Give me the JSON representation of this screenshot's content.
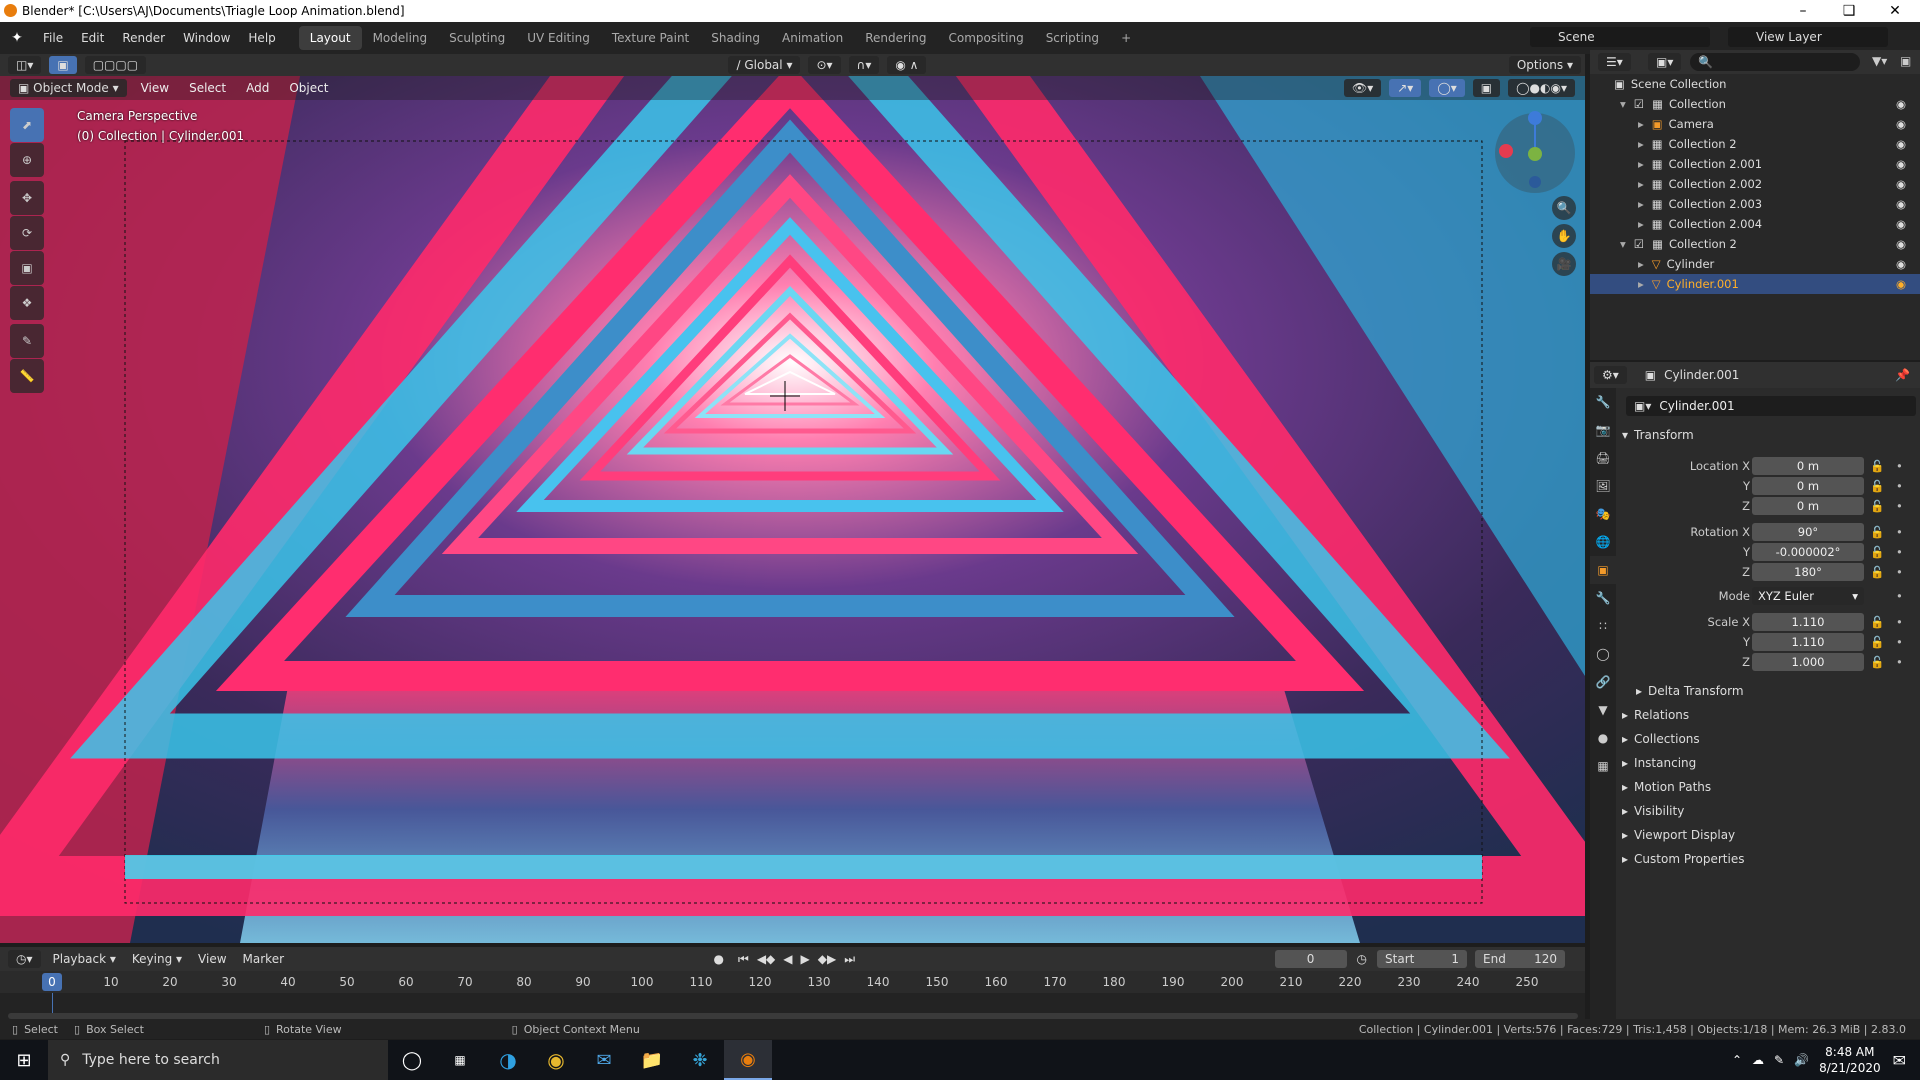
{
  "window": {
    "title": "Blender* [C:\\Users\\AJ\\Documents\\Triagle Loop Animation.blend]"
  },
  "menu": [
    "File",
    "Edit",
    "Render",
    "Window",
    "Help"
  ],
  "workspaces": [
    "Layout",
    "Modeling",
    "Sculpting",
    "UV Editing",
    "Texture Paint",
    "Shading",
    "Animation",
    "Rendering",
    "Compositing",
    "Scripting"
  ],
  "scene": {
    "name": "Scene",
    "view_layer": "View Layer"
  },
  "viewport_header": {
    "orientation": "Global",
    "options": "Options"
  },
  "viewport_menu": {
    "mode": "Object Mode",
    "items": [
      "View",
      "Select",
      "Add",
      "Object"
    ]
  },
  "viewport_overlay": {
    "line1": "Camera Perspective",
    "line2": "(0) Collection | Cylinder.001"
  },
  "outliner": {
    "root": "Scene Collection",
    "rows": [
      {
        "label": "Collection",
        "indent": 1
      },
      {
        "label": "Camera",
        "indent": 2
      },
      {
        "label": "Collection 2",
        "indent": 2
      },
      {
        "label": "Collection 2.001",
        "indent": 2
      },
      {
        "label": "Collection 2.002",
        "indent": 2
      },
      {
        "label": "Collection 2.003",
        "indent": 2
      },
      {
        "label": "Collection 2.004",
        "indent": 2
      },
      {
        "label": "Collection 2",
        "indent": 1
      },
      {
        "label": "Cylinder",
        "indent": 2
      },
      {
        "label": "Cylinder.001",
        "indent": 2
      }
    ]
  },
  "properties": {
    "header_object": "Cylinder.001",
    "object_name": "Cylinder.001",
    "transform_title": "Transform",
    "location_label": "Location X",
    "loc_x": "0 m",
    "loc_y": "0 m",
    "loc_z": "0 m",
    "rotation_label": "Rotation X",
    "rot_x": "90°",
    "rot_y": "-0.000002°",
    "rot_z": "180°",
    "mode_label": "Mode",
    "mode": "XYZ Euler",
    "scale_label": "Scale X",
    "scale_x": "1.110",
    "scale_y": "1.110",
    "scale_z": "1.000",
    "y": "Y",
    "z": "Z",
    "delta": "Delta Transform",
    "sections": [
      "Relations",
      "Collections",
      "Instancing",
      "Motion Paths",
      "Visibility",
      "Viewport Display",
      "Custom Properties"
    ]
  },
  "timeline": {
    "menus": [
      "Playback",
      "Keying",
      "View",
      "Marker"
    ],
    "current_frame": "0",
    "start_label": "Start",
    "start": "1",
    "end_label": "End",
    "end": "120",
    "frame_marker": "0",
    "ticks": [
      "10",
      "20",
      "30",
      "40",
      "50",
      "60",
      "70",
      "80",
      "90",
      "100",
      "110",
      "120",
      "130",
      "140",
      "150",
      "160",
      "170",
      "180",
      "190",
      "200",
      "210",
      "220",
      "230",
      "240",
      "250"
    ]
  },
  "statusbar": {
    "select": "Select",
    "box_select": "Box Select",
    "rotate": "Rotate View",
    "context": "Object Context Menu",
    "stats": "Collection | Cylinder.001 | Verts:576 | Faces:729 | Tris:1,458 | Objects:1/18 | Mem: 26.3 MiB | 2.83.0"
  },
  "taskbar": {
    "search": "Type here to search",
    "time": "8:48 AM",
    "date": "8/21/2020"
  }
}
